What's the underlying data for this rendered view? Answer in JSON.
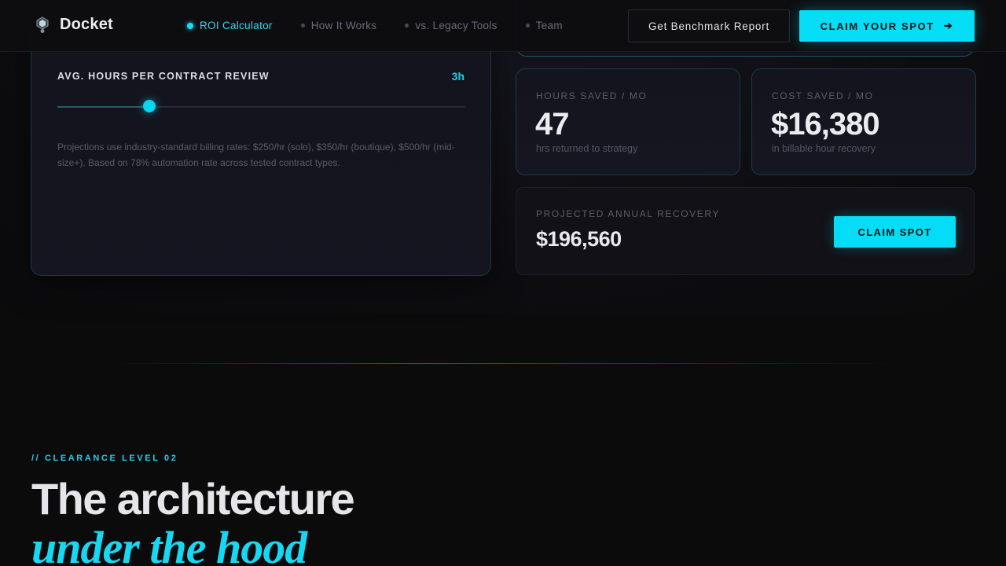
{
  "nav": {
    "brand": "Docket",
    "links": [
      {
        "label": "ROI Calculator",
        "active": true
      },
      {
        "label": "How It Works",
        "active": false
      },
      {
        "label": "vs. Legacy Tools",
        "active": false
      },
      {
        "label": "Team",
        "active": false
      }
    ],
    "benchmark_button": "Get Benchmark Report",
    "claim_button": "CLAIM YOUR SPOT",
    "claim_arrow": "➔"
  },
  "calculator": {
    "slider_label": "AVG. HOURS PER CONTRACT REVIEW",
    "slider_value": "3h",
    "slider_fraction": 0.225,
    "note": "Projections use industry-standard billing rates: $250/hr (solo), $350/hr (boutique), $500/hr (mid-size+). Based on 78% automation rate across tested contract types."
  },
  "stats": {
    "hours": {
      "label": "HOURS SAVED / MO",
      "value": "47",
      "sub": "hrs returned to strategy"
    },
    "cost": {
      "label": "COST SAVED / MO",
      "value": "$16,380",
      "sub": "in billable hour recovery"
    }
  },
  "annual": {
    "label": "PROJECTED ANNUAL RECOVERY",
    "value": "$196,560",
    "button": "CLAIM SPOT"
  },
  "section": {
    "eyebrow": "// CLEARANCE LEVEL 02",
    "headline": "The architecture",
    "headline_italic": "under the hood"
  },
  "colors": {
    "accent": "#05dcf6",
    "background": "#0b0b0c"
  }
}
